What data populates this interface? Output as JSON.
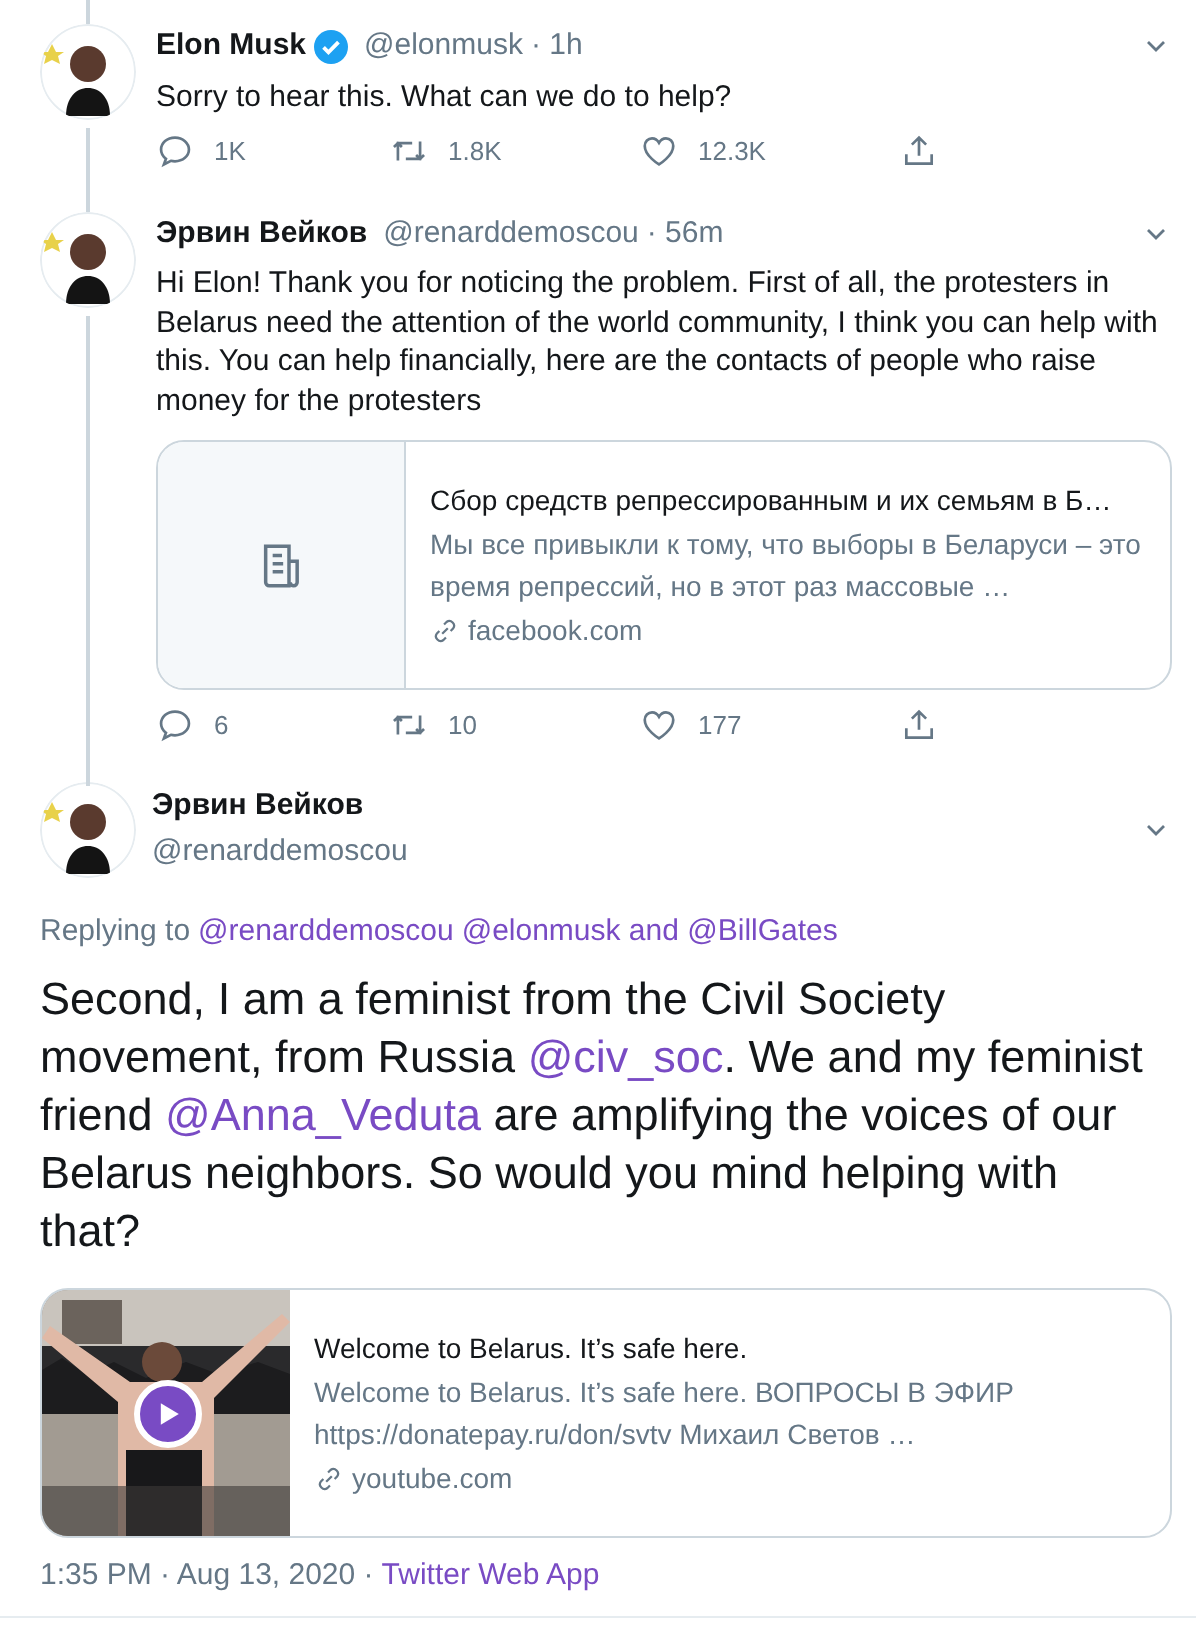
{
  "tweets": [
    {
      "kind": "reply",
      "name": "Elon Musk",
      "verified": true,
      "handle": "@elonmusk",
      "time": "· 1h",
      "text": "Sorry to hear this. What can we do to help?",
      "actions": [
        {
          "kind": "reply",
          "count": "1K"
        },
        {
          "kind": "retweet",
          "count": "1.8K"
        },
        {
          "kind": "like",
          "count": "12.3K"
        },
        {
          "kind": "share"
        }
      ]
    },
    {
      "kind": "reply",
      "name": "Эрвин Вейков",
      "verified": false,
      "handle": "@renarddemoscou",
      "time": "· 56m",
      "text": "Hi Elon! Thank you for noticing the problem. First of all, the protesters in Belarus need the attention of the world community, I think you can help with this. You can help financially, here are the contacts of people who raise money for the protesters",
      "card": {
        "kind": "article",
        "title": "Сбор средств репрессированным и их семьям в Б…",
        "description": "Мы все привыкли к тому, что выборы в Беларуси – это время репрессий, но в этот раз массовые …",
        "domain": "facebook.com"
      },
      "actions": [
        {
          "kind": "reply",
          "count": "6"
        },
        {
          "kind": "retweet",
          "count": "10"
        },
        {
          "kind": "like",
          "count": "177"
        },
        {
          "kind": "share"
        }
      ]
    },
    {
      "kind": "focus",
      "name": "Эрвин Вейков",
      "verified": false,
      "handle": "@renarddemoscou",
      "replying_to": [
        {
          "kind": "text",
          "text": "Replying to"
        },
        {
          "kind": "mention",
          "text": "@renarddemoscou"
        },
        {
          "kind": "mention",
          "text": "@elonmusk and @BillGates"
        }
      ],
      "text_parts": [
        {
          "kind": "text",
          "text": "Second, I am a feminist from the Civil Society movement, from Russia "
        },
        {
          "kind": "mention",
          "text": "@civ_soc"
        },
        {
          "kind": "text",
          "text": ". We and my feminist friend "
        },
        {
          "kind": "mention",
          "text": "@Anna_Veduta"
        },
        {
          "kind": "text",
          "text": " are amplifying the voices of our Belarus neighbors. So would you mind helping with that?"
        }
      ],
      "card": {
        "kind": "video",
        "title": "Welcome to Belarus. It’s safe here.",
        "description": "Welcome to Belarus. It’s safe here. ВОПРОСЫ В ЭФИР https://donatepay.ru/don/svtv Михаил Светов …",
        "domain": "youtube.com"
      },
      "timestamp": "1:35 PM · Aug 13, 2020 ·",
      "source": "Twitter Web App"
    }
  ]
}
